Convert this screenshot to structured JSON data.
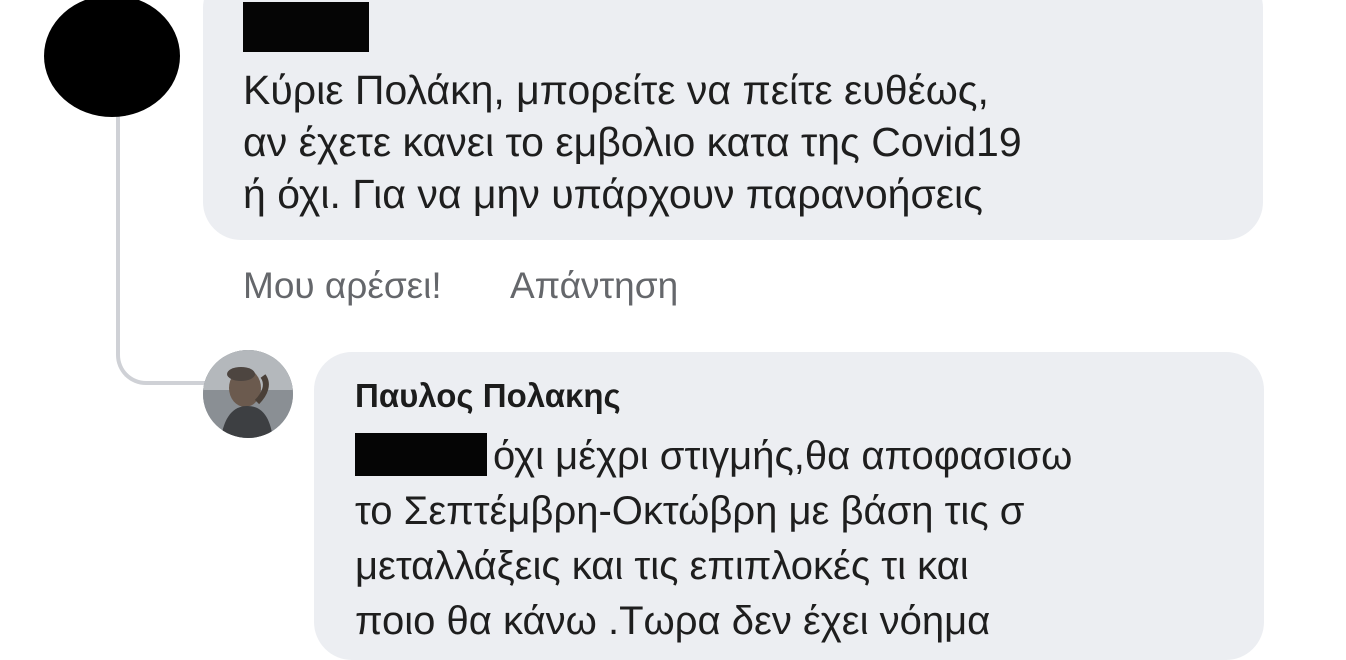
{
  "comment": {
    "lines": [
      "Κύριε Πολάκη, μπορείτε να πείτε ευθέως,",
      "αν έχετε κανει το εμβολιο κατα της Covid19",
      "ή όχι. Για να μην υπάρχουν παρανοήσεις"
    ],
    "actions": {
      "like": "Μου αρέσει!",
      "reply": "Απάντηση"
    }
  },
  "reply": {
    "author": "Παυλος Πολακης",
    "lines": [
      "όχι μέχρι στιγμής,θα αποφασισω",
      "το Σεπτέμβρη-Οκτώβρη με βάση τις σ",
      "μεταλλάξεις και τις επιπλοκές τι και",
      "ποιο θα κάνω .Τωρα δεν έχει νόημα"
    ]
  },
  "colors": {
    "bubble": "#eceef2",
    "action_text": "#65676b",
    "thread_line": "#cfd1d6",
    "redaction": "#050505"
  }
}
